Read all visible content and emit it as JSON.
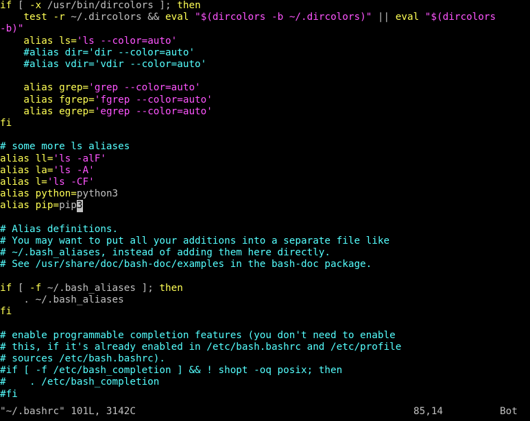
{
  "colors": {
    "background": "#000000",
    "keyword": "#ffff55",
    "string": "#ff55ff",
    "comment": "#55ffff",
    "text": "#c0c0c0",
    "cursor_bg": "#c0c0c0",
    "cursor_fg": "#000000"
  },
  "buffer": {
    "lines": [
      [
        {
          "t": "if",
          "c": "keyword"
        },
        {
          "t": " [ ",
          "c": "text"
        },
        {
          "t": "-x",
          "c": "keyword"
        },
        {
          "t": " /usr/bin/dircolors ]; ",
          "c": "text"
        },
        {
          "t": "then",
          "c": "keyword"
        }
      ],
      [
        {
          "t": "    test -r ",
          "c": "keyword"
        },
        {
          "t": "~/.dircolors",
          "c": "text"
        },
        {
          "t": " && ",
          "c": "text"
        },
        {
          "t": "eval",
          "c": "keyword"
        },
        {
          "t": " \"",
          "c": "string"
        },
        {
          "t": "$(",
          "c": "string"
        },
        {
          "t": "dircolors -b ",
          "c": "string"
        },
        {
          "t": "~/.dircolors",
          "c": "string"
        },
        {
          "t": ")",
          "c": "string"
        },
        {
          "t": "\"",
          "c": "string"
        },
        {
          "t": " || ",
          "c": "text"
        },
        {
          "t": "eval",
          "c": "keyword"
        },
        {
          "t": " \"",
          "c": "string"
        },
        {
          "t": "$(",
          "c": "string"
        },
        {
          "t": "dircolors",
          "c": "string"
        }
      ],
      [
        {
          "t": "-b)",
          "c": "string"
        },
        {
          "t": "\"",
          "c": "string"
        }
      ],
      [
        {
          "t": "    alias ls=",
          "c": "keyword"
        },
        {
          "t": "'ls --color=auto'",
          "c": "string"
        }
      ],
      [
        {
          "t": "    #alias dir='dir --color=auto'",
          "c": "comment"
        }
      ],
      [
        {
          "t": "    #alias vdir='vdir --color=auto'",
          "c": "comment"
        }
      ],
      [
        {
          "t": "",
          "c": "text"
        }
      ],
      [
        {
          "t": "    alias grep=",
          "c": "keyword"
        },
        {
          "t": "'grep --color=auto'",
          "c": "string"
        }
      ],
      [
        {
          "t": "    alias fgrep=",
          "c": "keyword"
        },
        {
          "t": "'fgrep --color=auto'",
          "c": "string"
        }
      ],
      [
        {
          "t": "    alias egrep=",
          "c": "keyword"
        },
        {
          "t": "'egrep --color=auto'",
          "c": "string"
        }
      ],
      [
        {
          "t": "fi",
          "c": "keyword"
        }
      ],
      [
        {
          "t": "",
          "c": "text"
        }
      ],
      [
        {
          "t": "# some more ls aliases",
          "c": "comment"
        }
      ],
      [
        {
          "t": "alias ll=",
          "c": "keyword"
        },
        {
          "t": "'ls -alF'",
          "c": "string"
        }
      ],
      [
        {
          "t": "alias la=",
          "c": "keyword"
        },
        {
          "t": "'ls -A'",
          "c": "string"
        }
      ],
      [
        {
          "t": "alias l=",
          "c": "keyword"
        },
        {
          "t": "'ls -CF'",
          "c": "string"
        }
      ],
      [
        {
          "t": "alias python=",
          "c": "keyword"
        },
        {
          "t": "python3",
          "c": "text"
        }
      ],
      [
        {
          "t": "alias pip=",
          "c": "keyword"
        },
        {
          "t": "pip",
          "c": "text"
        },
        {
          "t": "3",
          "c": "cursor"
        }
      ],
      [
        {
          "t": "",
          "c": "text"
        }
      ],
      [
        {
          "t": "# Alias definitions.",
          "c": "comment"
        }
      ],
      [
        {
          "t": "# You may want to put all your additions into a separate file like",
          "c": "comment"
        }
      ],
      [
        {
          "t": "# ~/.bash_aliases, instead of adding them here directly.",
          "c": "comment"
        }
      ],
      [
        {
          "t": "# See /usr/share/doc/bash-doc/examples in the bash-doc package.",
          "c": "comment"
        }
      ],
      [
        {
          "t": "",
          "c": "text"
        }
      ],
      [
        {
          "t": "if",
          "c": "keyword"
        },
        {
          "t": " [ ",
          "c": "text"
        },
        {
          "t": "-f",
          "c": "keyword"
        },
        {
          "t": " ~/.bash_aliases ]; ",
          "c": "text"
        },
        {
          "t": "then",
          "c": "keyword"
        }
      ],
      [
        {
          "t": "    . ~/.bash_aliases",
          "c": "text"
        }
      ],
      [
        {
          "t": "fi",
          "c": "keyword"
        }
      ],
      [
        {
          "t": "",
          "c": "text"
        }
      ],
      [
        {
          "t": "# enable programmable completion features (you don't need to enable",
          "c": "comment"
        }
      ],
      [
        {
          "t": "# this, if it's already enabled in /etc/bash.bashrc and /etc/profile",
          "c": "comment"
        }
      ],
      [
        {
          "t": "# sources /etc/bash.bashrc).",
          "c": "comment"
        }
      ],
      [
        {
          "t": "#if [ -f /etc/bash_completion ] && ! shopt -oq posix; then",
          "c": "comment"
        }
      ],
      [
        {
          "t": "#    . /etc/bash_completion",
          "c": "comment"
        }
      ],
      [
        {
          "t": "#fi",
          "c": "comment"
        }
      ]
    ]
  },
  "status_bar": {
    "file_info": "\"~/.bashrc\" 101L, 3142C",
    "position": "85,14",
    "scroll": "Bot"
  }
}
